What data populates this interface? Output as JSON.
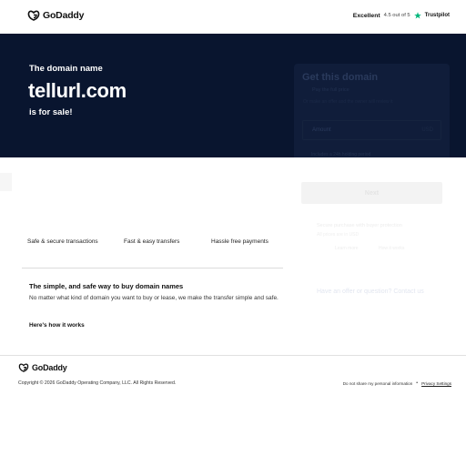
{
  "header": {
    "logo": {
      "icon": "godaddy-logo-icon",
      "text": "GoDaddy"
    },
    "rating": {
      "label": "Excellent",
      "score": "4.5 out of 5",
      "icon": "trustpilot-star-icon",
      "provider": "Trustpilot",
      "color": "#00b67a"
    }
  },
  "hero": {
    "eyebrow": "The domain name",
    "domain": "tellurl.com",
    "subtitle": "is for sale!",
    "background": "#09152f"
  },
  "offer_card": {
    "title": "Get this domain",
    "line1": "Pay the full price",
    "line2": "Or make an offer and the owner will review it",
    "input_placeholder": "Amount",
    "currency": "USD",
    "note": "Includes a 24h holding period",
    "button_label": "Next",
    "ghost_line_1": "Secure purchase with buyer protection",
    "ghost_line_2": "All prices are in USD",
    "ghost_line_3": "Learn more",
    "ghost_line_4": "How it works",
    "link": "Have an offer or question? Contact us"
  },
  "features": [
    {
      "label": "Safe & secure transactions"
    },
    {
      "label": "Fast & easy transfers"
    },
    {
      "label": "Hassle free payments"
    }
  ],
  "info": {
    "title": "The simple, and safe way to buy domain names",
    "body": "No matter what kind of domain you want to buy or lease, we make the transfer simple and safe.",
    "link": "Here's how it works"
  },
  "footer": {
    "logo": {
      "icon": "godaddy-logo-icon",
      "text": "GoDaddy"
    },
    "copyright": "Copyright © 2026 GoDaddy Operating Company, LLC. All Rights Reserved.",
    "links": [
      {
        "label": "Do not share my personal information"
      },
      {
        "label": "Privacy Settings"
      }
    ]
  }
}
